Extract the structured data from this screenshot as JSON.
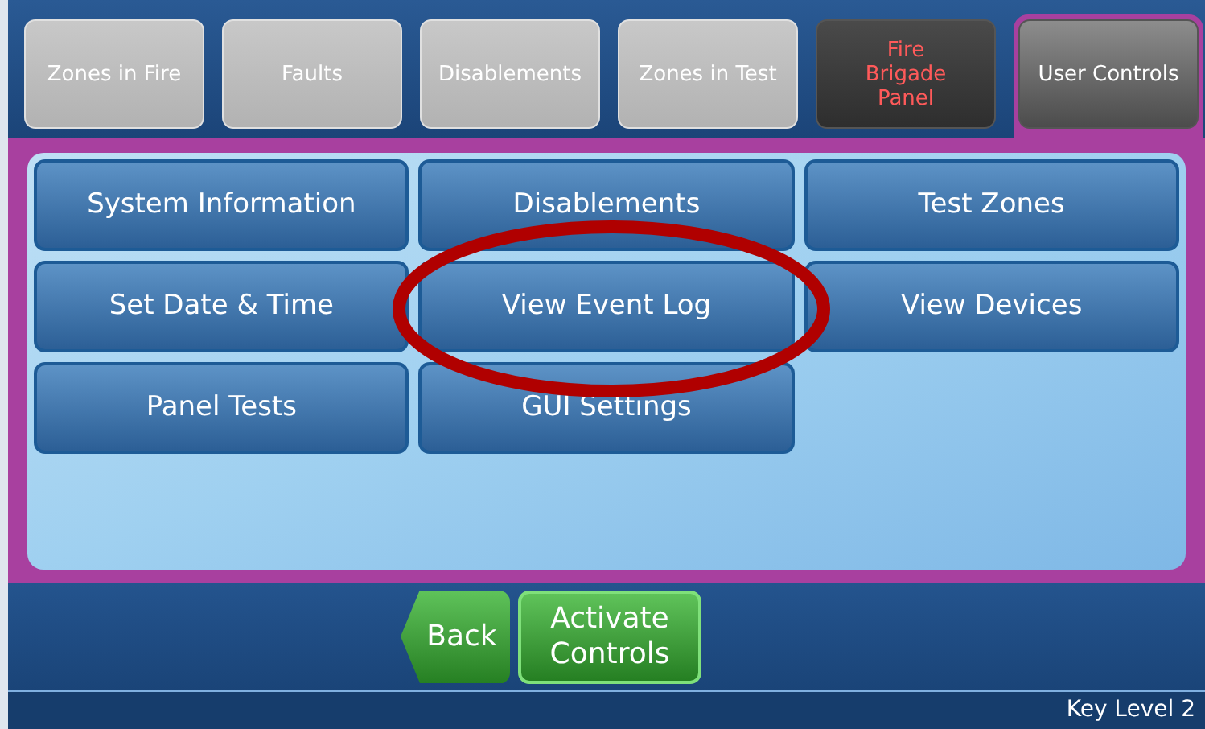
{
  "tabs": [
    {
      "label": "Zones in Fire",
      "kind": "normal",
      "selected": false
    },
    {
      "label": "Faults",
      "kind": "normal",
      "selected": false
    },
    {
      "label": "Disablements",
      "kind": "normal",
      "selected": false
    },
    {
      "label": "Zones in Test",
      "kind": "normal",
      "selected": false
    },
    {
      "label": "Fire Brigade Panel",
      "kind": "alert",
      "selected": false
    },
    {
      "label": "User Controls",
      "kind": "normal",
      "selected": true
    }
  ],
  "menu_buttons": [
    "System Information",
    "Disablements",
    "Test Zones",
    "Set Date & Time",
    "View Event Log",
    "View Devices",
    "Panel Tests",
    "GUI Settings"
  ],
  "action_buttons": [
    {
      "label": "Back",
      "kind": "back"
    },
    {
      "label": "Activate Controls",
      "kind": "normal"
    }
  ],
  "status_bar": "Key Level 2"
}
